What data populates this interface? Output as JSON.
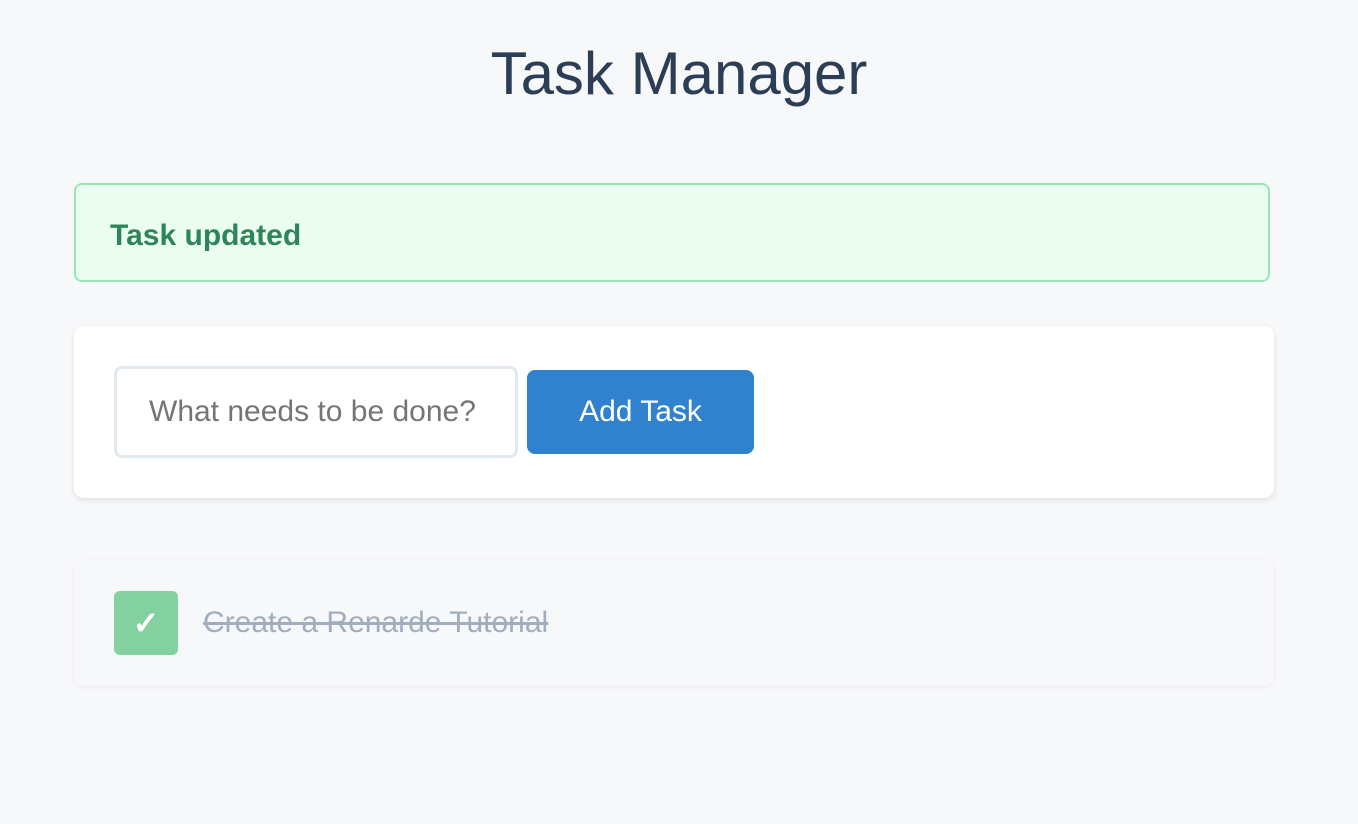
{
  "header": {
    "title": "Task Manager"
  },
  "alert": {
    "message": "Task updated"
  },
  "form": {
    "input_placeholder": "What needs to be done?",
    "input_value": "",
    "add_button_label": "Add Task"
  },
  "tasks": [
    {
      "label": "Create a Renarde Tutorial",
      "completed": true,
      "check_glyph": "✓"
    }
  ],
  "colors": {
    "page_background": "#f7f8fa",
    "title": "#2c3e55",
    "alert_background": "#ebfdf0",
    "alert_border": "#9ae6b4",
    "alert_text": "#2f855a",
    "primary_button": "#3182ce",
    "checkbox_done": "#84d1a0",
    "completed_task_text": "#a0aec0"
  },
  "icons": {
    "checkbox": "checkmark-icon"
  }
}
